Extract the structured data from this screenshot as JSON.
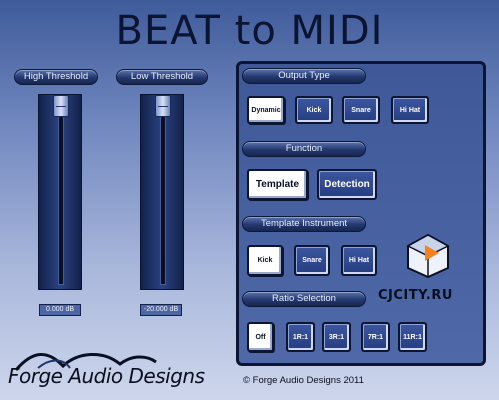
{
  "app": {
    "title": "BEAT to MIDI"
  },
  "sliders": {
    "high": {
      "label": "High Threshold",
      "value": "0.000 dB",
      "level": 1.0
    },
    "low": {
      "label": "Low Threshold",
      "value": "-20.000 dB",
      "level": 1.0
    }
  },
  "output_type": {
    "label": "Output Type",
    "options": [
      "Dynamic",
      "Kick",
      "Snare",
      "Hi Hat"
    ],
    "selected": "Dynamic"
  },
  "function": {
    "label": "Function",
    "options": [
      "Template",
      "Detection"
    ],
    "selected": "Template"
  },
  "template_instrument": {
    "label": "Template Instrument",
    "options": [
      "Kick",
      "Snare",
      "Hi Hat"
    ],
    "selected": "Kick"
  },
  "ratio_selection": {
    "label": "Ratio Selection",
    "options": [
      "Off",
      "1R:1",
      "3R:1",
      "7R:1",
      "11R:1"
    ],
    "selected": "Off"
  },
  "watermark": "CJCITY.RU",
  "footer": {
    "brand": "Forge Audio Designs",
    "copyright": "© Forge Audio Designs 2011"
  },
  "colors": {
    "accent": "#f5821f",
    "panel": "#4f69a8",
    "dark": "#0c1532"
  }
}
